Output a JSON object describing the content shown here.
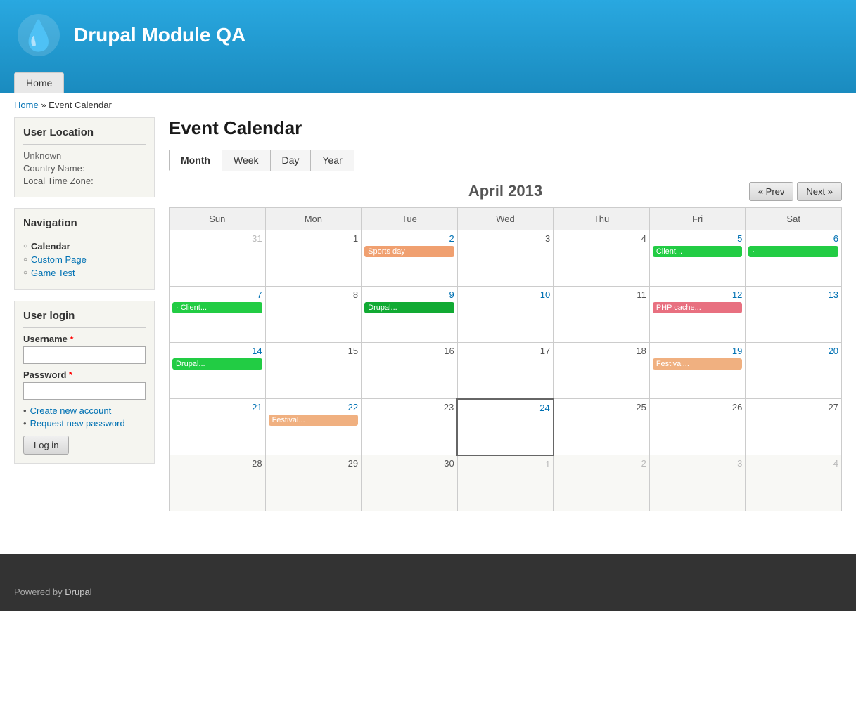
{
  "header": {
    "site_title": "Drupal Module QA",
    "nav_home": "Home"
  },
  "breadcrumb": {
    "home": "Home",
    "separator": "»",
    "current": "Event Calendar"
  },
  "sidebar": {
    "user_location": {
      "title": "User Location",
      "unknown": "Unknown",
      "country_label": "Country Name:",
      "timezone_label": "Local Time Zone:"
    },
    "navigation": {
      "title": "Navigation",
      "items": [
        {
          "label": "Calendar",
          "link": false
        },
        {
          "label": "Custom Page",
          "link": true
        },
        {
          "label": "Game Test",
          "link": true
        }
      ]
    },
    "user_login": {
      "title": "User login",
      "username_label": "Username",
      "password_label": "Password",
      "create_account": "Create new account",
      "request_password": "Request new password",
      "login_btn": "Log in"
    }
  },
  "calendar": {
    "page_title": "Event Calendar",
    "tabs": [
      "Month",
      "Week",
      "Day",
      "Year"
    ],
    "active_tab": "Month",
    "nav_prev": "« Prev",
    "nav_next": "Next »",
    "month_year": "April 2013",
    "day_headers": [
      "Sun",
      "Mon",
      "Tue",
      "Wed",
      "Thu",
      "Fri",
      "Sat"
    ],
    "weeks": [
      {
        "days": [
          {
            "num": "31",
            "muted": true,
            "events": []
          },
          {
            "num": "1",
            "dark": true,
            "events": []
          },
          {
            "num": "2",
            "events": [
              {
                "label": "Sports day",
                "color": "ev-orange"
              }
            ]
          },
          {
            "num": "3",
            "dark": true,
            "events": []
          },
          {
            "num": "4",
            "dark": true,
            "events": []
          },
          {
            "num": "5",
            "events": [
              {
                "label": "Client...",
                "color": "ev-green"
              }
            ]
          },
          {
            "num": "6",
            "events": [
              {
                "label": "·",
                "color": "ev-green"
              }
            ]
          }
        ]
      },
      {
        "days": [
          {
            "num": "7",
            "events": [
              {
                "label": "· Client...",
                "color": "ev-green"
              }
            ]
          },
          {
            "num": "8",
            "dark": true,
            "events": []
          },
          {
            "num": "9",
            "events": [
              {
                "label": "Drupal...",
                "color": "ev-green-dark"
              }
            ]
          },
          {
            "num": "10",
            "events": []
          },
          {
            "num": "11",
            "dark": true,
            "events": []
          },
          {
            "num": "12",
            "events": [
              {
                "label": "PHP cache...",
                "color": "ev-pink"
              }
            ]
          },
          {
            "num": "13",
            "events": []
          }
        ]
      },
      {
        "days": [
          {
            "num": "14",
            "events": [
              {
                "label": "Drupal...",
                "color": "ev-green"
              }
            ]
          },
          {
            "num": "15",
            "dark": true,
            "events": []
          },
          {
            "num": "16",
            "dark": true,
            "events": []
          },
          {
            "num": "17",
            "dark": true,
            "events": []
          },
          {
            "num": "18",
            "dark": true,
            "events": []
          },
          {
            "num": "19",
            "events": [
              {
                "label": "Festival...",
                "color": "ev-peach"
              }
            ]
          },
          {
            "num": "20",
            "events": []
          }
        ]
      },
      {
        "days": [
          {
            "num": "21",
            "events": []
          },
          {
            "num": "22",
            "events": [
              {
                "label": "Festival...",
                "color": "ev-peach"
              }
            ]
          },
          {
            "num": "23",
            "dark": true,
            "events": []
          },
          {
            "num": "24",
            "today": true,
            "events": []
          },
          {
            "num": "25",
            "dark": true,
            "events": []
          },
          {
            "num": "26",
            "dark": true,
            "events": []
          },
          {
            "num": "27",
            "dark": true,
            "events": []
          }
        ]
      },
      {
        "other_month": true,
        "days": [
          {
            "num": "28",
            "dark": true,
            "events": []
          },
          {
            "num": "29",
            "dark": true,
            "events": []
          },
          {
            "num": "30",
            "dark": true,
            "events": []
          },
          {
            "num": "1",
            "muted": true,
            "events": []
          },
          {
            "num": "2",
            "muted": true,
            "events": []
          },
          {
            "num": "3",
            "muted": true,
            "events": []
          },
          {
            "num": "4",
            "muted": true,
            "events": []
          }
        ]
      }
    ]
  },
  "footer": {
    "powered_by": "Powered by",
    "drupal": "Drupal"
  }
}
